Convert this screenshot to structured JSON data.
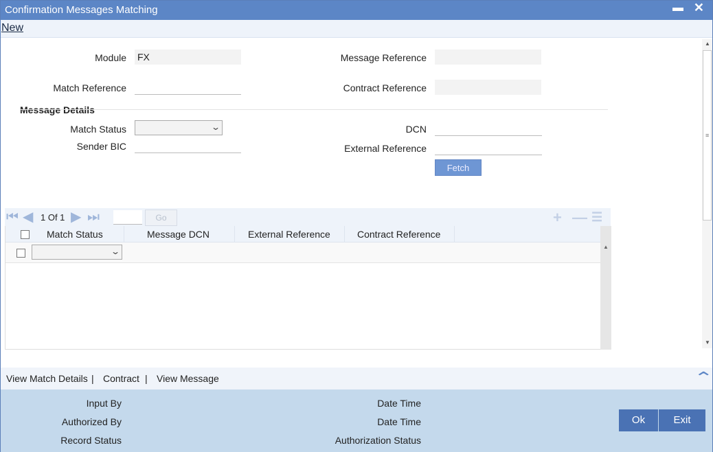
{
  "window": {
    "title": "Confirmation Messages Matching",
    "minimize_glyph": "▬",
    "close_glyph": "✕"
  },
  "menu": {
    "new_label": "New"
  },
  "form": {
    "module_label": "Module",
    "module_value": "FX",
    "message_reference_label": "Message Reference",
    "message_reference_value": "",
    "match_reference_label": "Match Reference",
    "match_reference_value": "",
    "contract_reference_label": "Contract Reference",
    "contract_reference_value": "",
    "section_title": "Message Details",
    "match_status_label": "Match Status",
    "match_status_value": "",
    "dcn_label": "DCN",
    "dcn_value": "",
    "sender_bic_label": "Sender BIC",
    "sender_bic_value": "",
    "external_reference_label": "External Reference",
    "external_reference_value": "",
    "fetch_label": "Fetch"
  },
  "grid": {
    "page_info": "1 Of 1",
    "go_label": "Go",
    "columns": [
      "Match Status",
      "Message DCN",
      "External Reference",
      "Contract Reference"
    ],
    "rows": [
      {
        "match_status": "",
        "message_dcn": "",
        "external_reference": "",
        "contract_reference": ""
      }
    ]
  },
  "links": {
    "view_match_details": "View Match Details",
    "contract": "Contract",
    "view_message": "View Message",
    "separator": "|"
  },
  "footer": {
    "input_by_label": "Input By",
    "authorized_by_label": "Authorized By",
    "record_status_label": "Record Status",
    "date_time_label_1": "Date Time",
    "date_time_label_2": "Date Time",
    "authorization_status_label": "Authorization Status",
    "ok_label": "Ok",
    "exit_label": "Exit"
  },
  "colors": {
    "titlebar": "#5c86c6",
    "footer": "#c4d9ec",
    "button": "#4a72b4"
  }
}
